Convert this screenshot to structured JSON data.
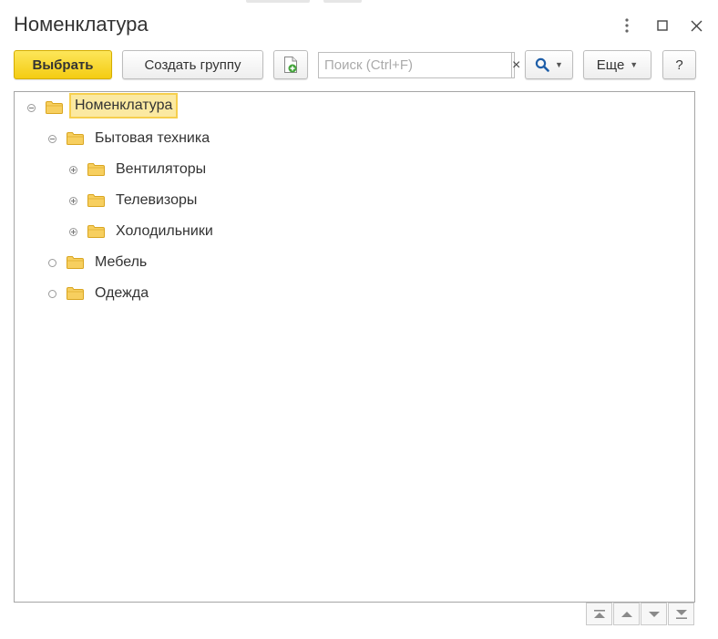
{
  "window": {
    "title": "Номенклатура"
  },
  "toolbar": {
    "select_label": "Выбрать",
    "create_group_label": "Создать группу",
    "search_placeholder": "Поиск (Ctrl+F)",
    "search_clear": "×",
    "more_label": "Еще",
    "help_label": "?"
  },
  "tree": {
    "items": [
      {
        "label": "Номенклатура",
        "expander": "minus",
        "selected": true
      },
      {
        "label": "Бытовая техника",
        "expander": "minus"
      },
      {
        "label": "Вентиляторы",
        "expander": "plus"
      },
      {
        "label": "Телевизоры",
        "expander": "plus"
      },
      {
        "label": "Холодильники",
        "expander": "plus"
      },
      {
        "label": "Мебель",
        "expander": "leaf"
      },
      {
        "label": "Одежда",
        "expander": "leaf"
      }
    ]
  },
  "colors": {
    "primary_button": "#f4cc12",
    "selection_fill": "#fbe9a1",
    "selection_border": "#f6cf4d",
    "folder": "#f7cf5f",
    "search_icon": "#1e5ea8"
  },
  "icons": {
    "more_options": "vertical-dots-icon",
    "maximize": "square-icon",
    "close": "close-x-icon",
    "add_item": "document-plus-icon",
    "search": "magnifier-icon",
    "folder": "folder-icon",
    "move_top": "double-up-arrow-icon",
    "move_up": "up-arrow-icon",
    "move_down": "down-arrow-icon",
    "move_bottom": "double-down-arrow-icon"
  }
}
